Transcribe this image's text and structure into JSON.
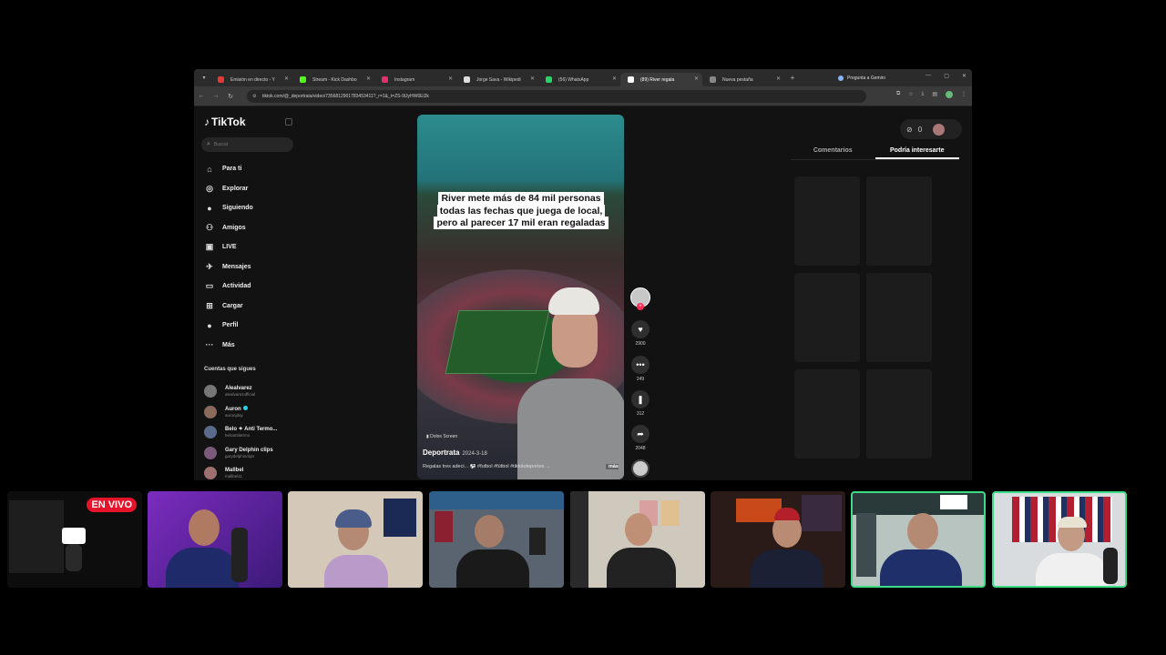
{
  "browser": {
    "tabs": [
      {
        "label": "Emisión en directo - Y",
        "fav": "#e53935",
        "active": false
      },
      {
        "label": "Stream - Kick Dashbo",
        "fav": "#53fc18",
        "active": false
      },
      {
        "label": "Instagram",
        "fav": "#e1306c",
        "active": false
      },
      {
        "label": "Jorge Sava - Wikipedi",
        "fav": "#dddddd",
        "active": false
      },
      {
        "label": "(56) WhatsApp",
        "fav": "#25d366",
        "active": false
      },
      {
        "label": "(89) River regala",
        "fav": "#ffffff",
        "active": true
      },
      {
        "label": "Nueva pestaña",
        "fav": "#888888",
        "active": false
      }
    ],
    "gemini_label": "Pregunta a Gemini",
    "url": "tiktok.com/@_deportrata/video/7356812901783453411?_r=1&_t=ZS-9lJyHW6Ei2k"
  },
  "tiktok": {
    "logo": "TikTok",
    "search_placeholder": "Buscar",
    "nav": [
      {
        "label": "Para ti",
        "icon": "home-icon",
        "glyph": "⌂"
      },
      {
        "label": "Explorar",
        "icon": "compass-icon",
        "glyph": "◎"
      },
      {
        "label": "Siguiendo",
        "icon": "following-icon",
        "glyph": "●"
      },
      {
        "label": "Amigos",
        "icon": "friends-icon",
        "glyph": "⚇"
      },
      {
        "label": "LIVE",
        "icon": "live-icon",
        "glyph": "▣"
      },
      {
        "label": "Mensajes",
        "icon": "messages-icon",
        "glyph": "✈"
      },
      {
        "label": "Actividad",
        "icon": "activity-icon",
        "glyph": "▭"
      },
      {
        "label": "Cargar",
        "icon": "upload-icon",
        "glyph": "⊞"
      },
      {
        "label": "Perfil",
        "icon": "profile-icon",
        "glyph": "●"
      },
      {
        "label": "Más",
        "icon": "more-icon",
        "glyph": "···"
      }
    ],
    "following_title": "Cuentas que sigues",
    "following": [
      {
        "name": "Alealvarez",
        "handle": "alealvarezofficial",
        "color": "#777777",
        "verified": false
      },
      {
        "name": "Auron",
        "handle": "auronplay",
        "color": "#8a6a5a",
        "verified": true
      },
      {
        "name": "Belo ✦ Anti Termo...",
        "handle": "beloantitermo",
        "color": "#5a6a8a",
        "verified": false
      },
      {
        "name": "Gary Delphin clips",
        "handle": "garydelphinclips",
        "color": "#7a5a7a",
        "verified": false
      },
      {
        "name": "Mallbel",
        "handle": "mallbel11",
        "color": "#a07070",
        "verified": false
      }
    ]
  },
  "video": {
    "caption": "River mete más de 84 mil personas todas las fechas que juega de local, pero al parecer 17 mil eran regaladas",
    "author": "Deportrata",
    "date": "2024-3-18",
    "sub_label": "Dolos Screen",
    "description": "Regalas tres adeci... ⚽ #futbol #fútbol #tiktokdeportes ...",
    "more_label": "más",
    "likes": "2900",
    "comments": "249",
    "saves": "312",
    "shares": "2048"
  },
  "right_panel": {
    "counter": "0",
    "tabs": [
      {
        "label": "Comentarios",
        "active": false
      },
      {
        "label": "Podría interesarte",
        "active": true
      }
    ]
  },
  "stream": {
    "live_badge": "EN VIVO"
  }
}
